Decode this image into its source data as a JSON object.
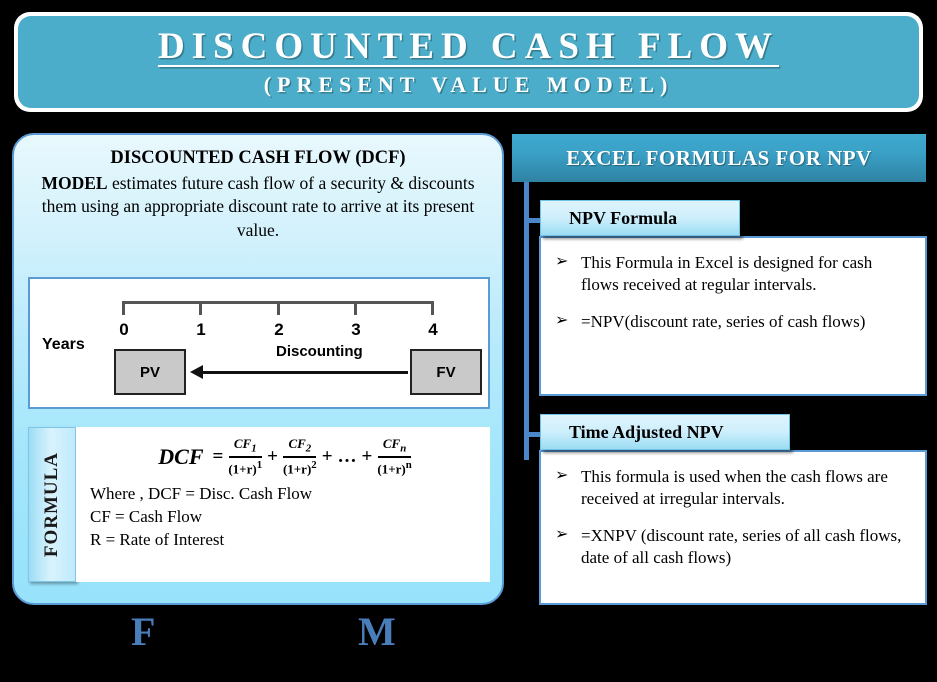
{
  "header": {
    "title": "DISCOUNTED CASH FLOW",
    "subtitle": "(PRESENT VALUE MODEL)",
    "bg_color": "#4badc9"
  },
  "left_panel": {
    "dcf_title": "DISCOUNTED CASH  FLOW (DCF)",
    "dcf_strong": "MODEL",
    "dcf_body": " estimates future cash flow of a security & discounts them using an appropriate discount rate to arrive at its present value.",
    "timeline": {
      "axis_label": "Years",
      "ticks": [
        "0",
        "1",
        "2",
        "3",
        "4"
      ],
      "present_box": "PV",
      "future_box": "FV",
      "arrow_label": "Discounting"
    },
    "formula": {
      "tab_label": "FORMULA",
      "lhs": "DCF",
      "equals": "=",
      "terms": [
        {
          "num": "CF",
          "sub": "1",
          "den": "(1+r)",
          "exp": "1"
        },
        {
          "num": "CF",
          "sub": "2",
          "den": "(1+r)",
          "exp": "2"
        },
        {
          "num": "CF",
          "sub": "n",
          "den": "(1+r)",
          "exp": "n"
        }
      ],
      "plus": "+",
      "ellipsis": "…",
      "where": [
        "Where , DCF = Disc. Cash Flow",
        "CF = Cash Flow",
        "R = Rate of Interest"
      ]
    }
  },
  "right_panel": {
    "header": "EXCEL FORMULAS FOR NPV",
    "sections": [
      {
        "label": "NPV Formula",
        "bullets": [
          "This Formula in Excel is designed for cash flows received at regular intervals.",
          "=NPV(discount rate, series of cash flows)"
        ]
      },
      {
        "label": "Time Adjusted NPV",
        "bullets": [
          "This formula is used when the cash flows are received at irregular intervals.",
          "=XNPV (discount rate, series of all cash flows, date of all cash flows)"
        ]
      }
    ],
    "bullet_marker": "➢"
  },
  "bottom": {
    "letter_left": "F",
    "letter_right": "M",
    "color": "#4a7ebb"
  }
}
